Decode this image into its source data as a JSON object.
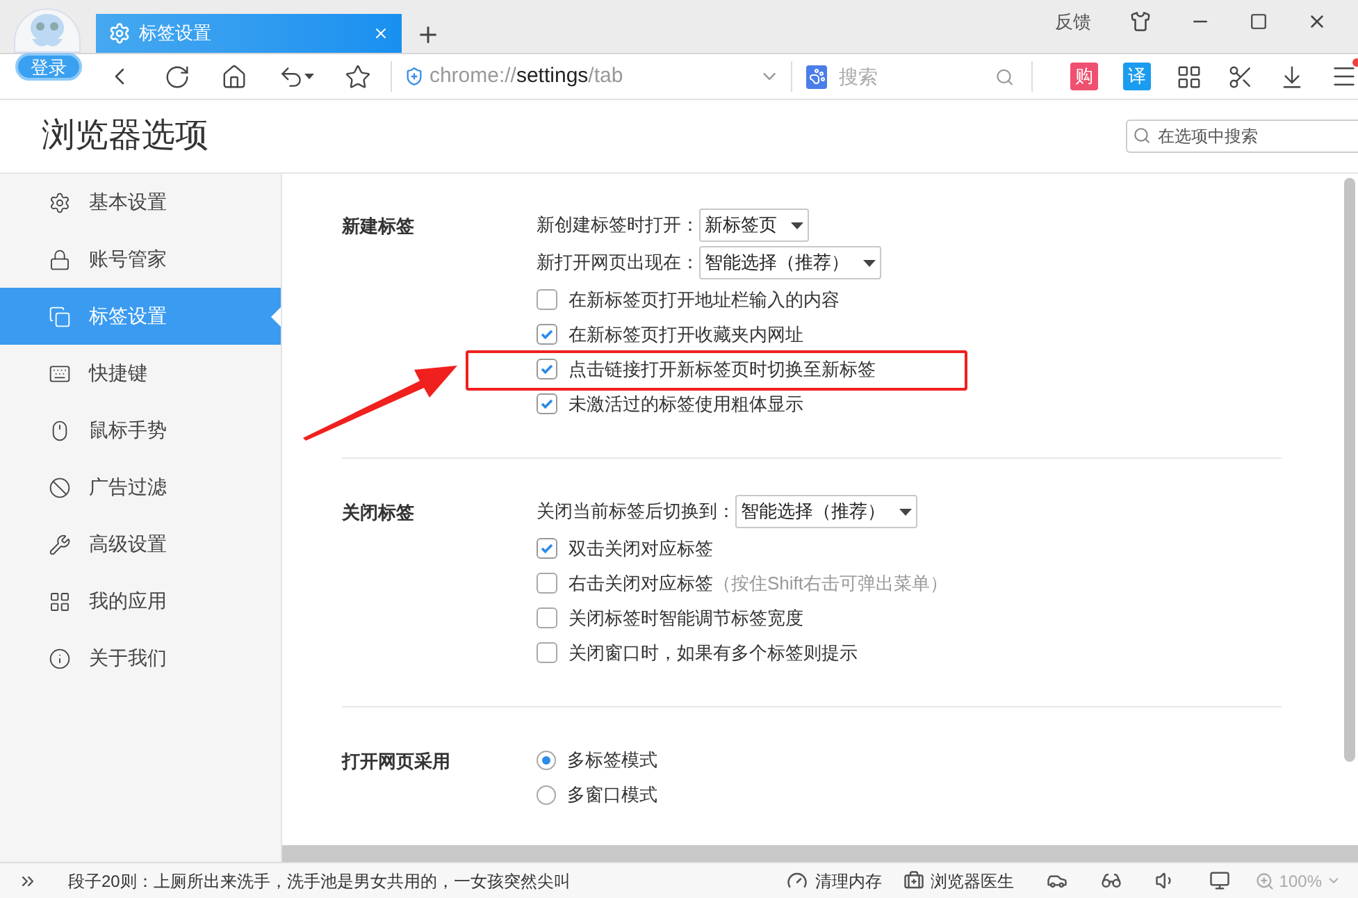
{
  "titlebar": {
    "login": "登录",
    "tab": {
      "title": "标签设置"
    },
    "feedback": "反馈"
  },
  "toolbar": {
    "url": [
      {
        "text": "chrome://",
        "dim": true
      },
      {
        "text": "settings",
        "dim": false
      },
      {
        "text": "/tab",
        "dim": true
      }
    ],
    "search": {
      "placeholder": "搜索"
    },
    "shop": "购",
    "translate": "译"
  },
  "page": {
    "title": "浏览器选项",
    "search": {
      "placeholder": "在选项中搜索"
    }
  },
  "sidebar": {
    "items": [
      {
        "label": "基本设置",
        "selected": false
      },
      {
        "label": "账号管家",
        "selected": false
      },
      {
        "label": "标签设置",
        "selected": true
      },
      {
        "label": "快捷键",
        "selected": false
      },
      {
        "label": "鼠标手势",
        "selected": false
      },
      {
        "label": "广告过滤",
        "selected": false
      },
      {
        "label": "高级设置",
        "selected": false
      },
      {
        "label": "我的应用",
        "selected": false
      },
      {
        "label": "关于我们",
        "selected": false
      }
    ]
  },
  "sections": [
    {
      "title": "新建标签",
      "rows": [
        {
          "kind": "select",
          "label": "新创建标签时打开：",
          "value": "新标签页"
        },
        {
          "kind": "select",
          "label": "新打开网页出现在：",
          "value": "智能选择（推荐）"
        },
        {
          "kind": "checkbox",
          "label": "在新标签页打开地址栏输入的内容",
          "checked": false
        },
        {
          "kind": "checkbox",
          "label": "在新标签页打开收藏夹内网址",
          "checked": true
        },
        {
          "kind": "checkbox",
          "label": "点击链接打开新标签页时切换至新标签",
          "checked": true,
          "highlighted": true
        },
        {
          "kind": "checkbox",
          "label": "未激活过的标签使用粗体显示",
          "checked": true
        }
      ]
    },
    {
      "title": "关闭标签",
      "rows": [
        {
          "kind": "select",
          "label": "关闭当前标签后切换到：",
          "value": "智能选择（推荐）"
        },
        {
          "kind": "checkbox",
          "label": "双击关闭对应标签",
          "checked": true
        },
        {
          "kind": "checkbox",
          "label": "右击关闭对应标签",
          "hint": "（按住Shift右击可弹出菜单）",
          "checked": false
        },
        {
          "kind": "checkbox",
          "label": "关闭标签时智能调节标签宽度",
          "checked": false
        },
        {
          "kind": "checkbox",
          "label": "关闭窗口时，如果有多个标签则提示",
          "checked": false
        }
      ]
    },
    {
      "title": "打开网页采用",
      "rows": [
        {
          "kind": "radio",
          "label": "多标签模式",
          "selected": true
        },
        {
          "kind": "radio",
          "label": "多窗口模式",
          "selected": false
        }
      ]
    }
  ],
  "statusbar": {
    "news": "段子20则：上厕所出来洗手，洗手池是男女共用的，一女孩突然尖叫",
    "clean": "清理内存",
    "doctor": "浏览器医生",
    "zoom": "100%"
  }
}
